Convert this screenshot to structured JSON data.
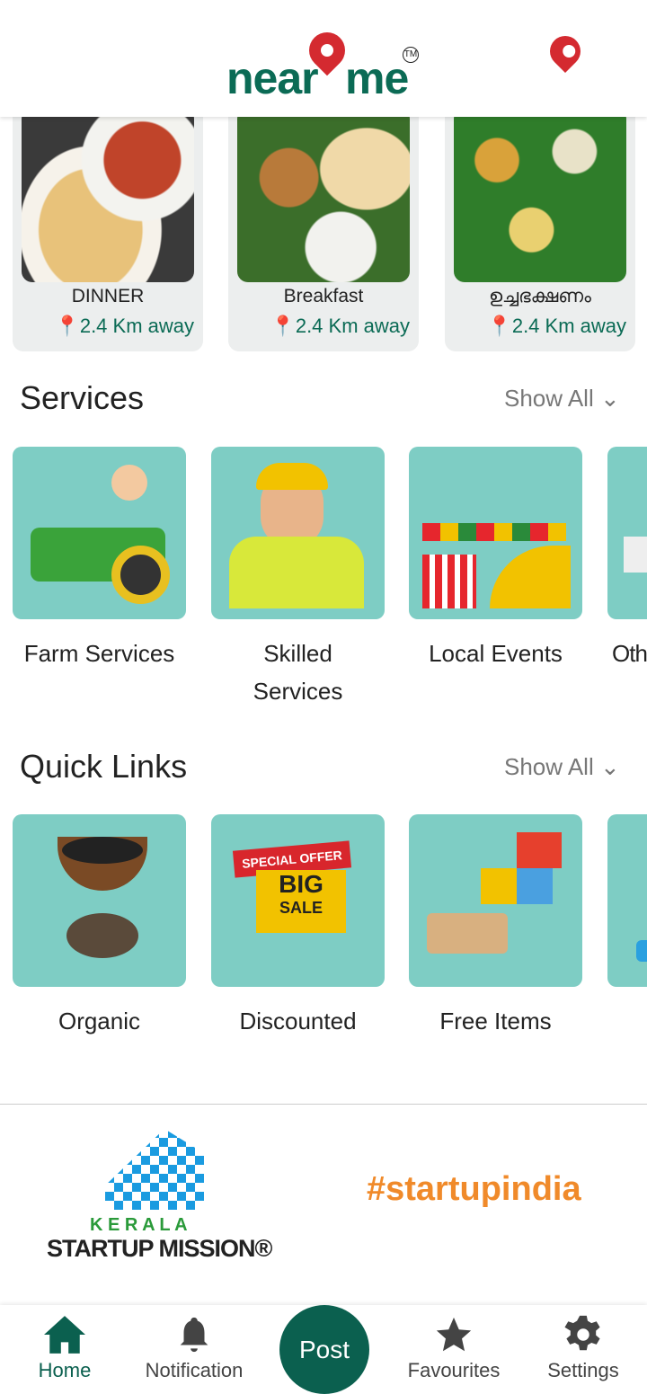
{
  "header": {
    "logo_text_left": "near",
    "logo_text_right": "me",
    "logo_tm": "TM",
    "location_icon": "map-pin-icon"
  },
  "food_cards": [
    {
      "label": "DINNER",
      "distance": "2.4 Km away"
    },
    {
      "label": "Breakfast",
      "distance": "2.4 Km away"
    },
    {
      "label": "ഉച്ചഭക്ഷണം",
      "distance": "2.4 Km away"
    }
  ],
  "services": {
    "title": "Services",
    "show_all": "Show All",
    "items": [
      {
        "label": "Farm Services"
      },
      {
        "label": "Skilled Services"
      },
      {
        "label": "Local Events"
      },
      {
        "label": "Oth"
      }
    ]
  },
  "quick_links": {
    "title": "Quick Links",
    "show_all": "Show All",
    "items": [
      {
        "label": "Organic"
      },
      {
        "label": "Discounted"
      },
      {
        "label": "Free Items"
      },
      {
        "label": ""
      }
    ]
  },
  "sale_badge": {
    "top": "SPECIAL OFFER",
    "big": "BIG",
    "small": "SALE"
  },
  "partners": {
    "ksum_top": "K E R A L A",
    "ksum_bottom": "STARTUP MISSION",
    "startupindia": "#startupindia"
  },
  "nav": {
    "home": "Home",
    "notification": "Notification",
    "post": "Post",
    "favourites": "Favourites",
    "settings": "Settings"
  },
  "colors": {
    "brand_green": "#0b6b55",
    "brand_red": "#d42a30",
    "tile_bg": "#7ecdc4"
  }
}
